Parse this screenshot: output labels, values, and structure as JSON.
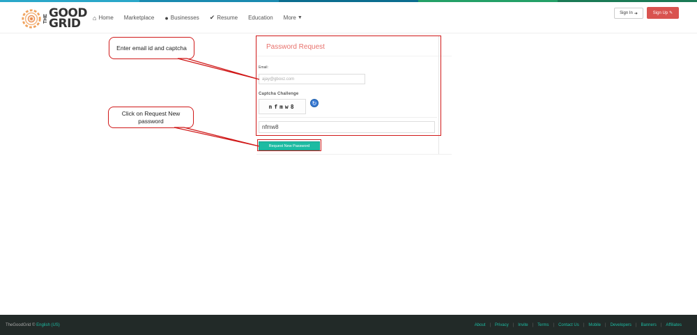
{
  "colors": {
    "brand_red": "#d9534f",
    "teal": "#1dbba2",
    "annotation_red": "#d01818",
    "title_red": "#e8716b",
    "footer_bg": "#222a28",
    "stripe": [
      "#2aa7c9",
      "#1a8ab0",
      "#0b6d8f",
      "#24a067",
      "#1b7a55"
    ]
  },
  "logo": {
    "the": "THE",
    "good": "GOOD",
    "grid": "GRID"
  },
  "nav": {
    "items": [
      {
        "label": "Home",
        "icon": "home-icon"
      },
      {
        "label": "Marketplace",
        "icon": ""
      },
      {
        "label": "Businesses",
        "icon": "globe-icon"
      },
      {
        "label": "Resume",
        "icon": "check-icon"
      },
      {
        "label": "Education",
        "icon": ""
      },
      {
        "label": "More",
        "icon": "caret-down-icon"
      }
    ]
  },
  "header": {
    "signin_label": "Sign In",
    "signup_label": "Sign Up"
  },
  "form": {
    "title": "Password Request",
    "email_label": "Email:",
    "email_placeholder": "ajay@gboxz.com",
    "captcha_label": "Captcha Challenge",
    "captcha_text": "nfmw8",
    "captcha_input_value": "nfmw8",
    "submit_label": "Request New Password"
  },
  "annotations": {
    "callout_1": "Enter email id and captcha",
    "callout_2": "Click on Request New password"
  },
  "footer": {
    "brand": "TheGoodGrid ©",
    "language": "English (US)",
    "links": [
      "About",
      "Privacy",
      "Invite",
      "Terms",
      "Contact Us",
      "Mobile",
      "Developers",
      "Banners",
      "Affiliates"
    ]
  }
}
